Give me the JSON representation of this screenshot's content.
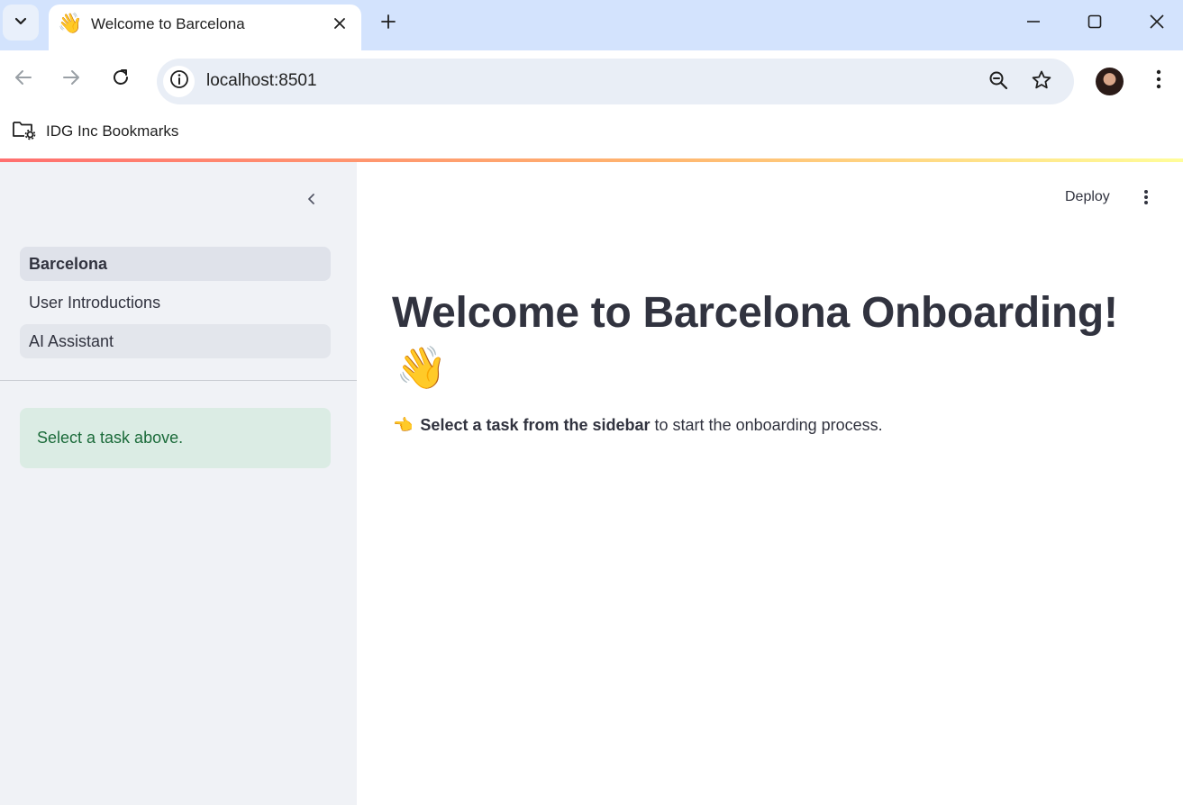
{
  "browser": {
    "tab": {
      "favicon": "👋",
      "title": "Welcome to Barcelona"
    },
    "address": {
      "url": "localhost:8501"
    },
    "bookmarks": [
      {
        "label": "IDG Inc Bookmarks"
      }
    ]
  },
  "sidebar": {
    "nav_items": [
      {
        "label": "Barcelona",
        "active": true
      },
      {
        "label": "User Introductions",
        "active": false
      },
      {
        "label": "AI Assistant",
        "active": false
      }
    ],
    "info_message": "Select a task above."
  },
  "main": {
    "deploy_label": "Deploy",
    "heading": "Welcome to Barcelona Onboarding!",
    "heading_emoji": "👋",
    "instruction_emoji": "👈",
    "instruction_bold": "Select a task from the sidebar",
    "instruction_rest": "to start the onboarding process."
  },
  "colors": {
    "tabstrip": "#d3e3fd",
    "sidebar_bg": "#f0f2f6",
    "info_bg": "#dbece4",
    "info_text": "#1b6b3a",
    "text": "#31333f"
  }
}
